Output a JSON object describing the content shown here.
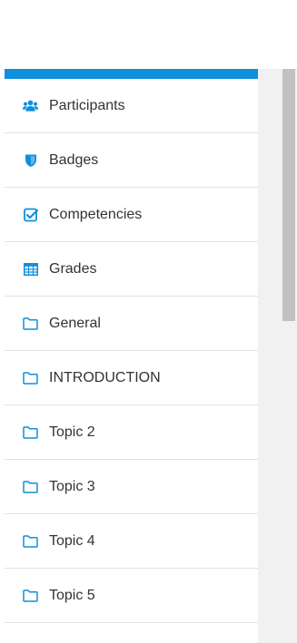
{
  "nav": {
    "accent_color": "#0f8fdb",
    "icon_color": "#0f8fdb",
    "items": [
      {
        "label": "Participants",
        "icon": "users-icon"
      },
      {
        "label": "Badges",
        "icon": "shield-icon"
      },
      {
        "label": "Competencies",
        "icon": "checkbox-icon"
      },
      {
        "label": "Grades",
        "icon": "table-icon"
      },
      {
        "label": "General",
        "icon": "folder-icon"
      },
      {
        "label": "INTRODUCTION",
        "icon": "folder-icon"
      },
      {
        "label": "Topic 2",
        "icon": "folder-icon"
      },
      {
        "label": "Topic 3",
        "icon": "folder-icon"
      },
      {
        "label": "Topic 4",
        "icon": "folder-icon"
      },
      {
        "label": "Topic 5",
        "icon": "folder-icon"
      }
    ]
  }
}
